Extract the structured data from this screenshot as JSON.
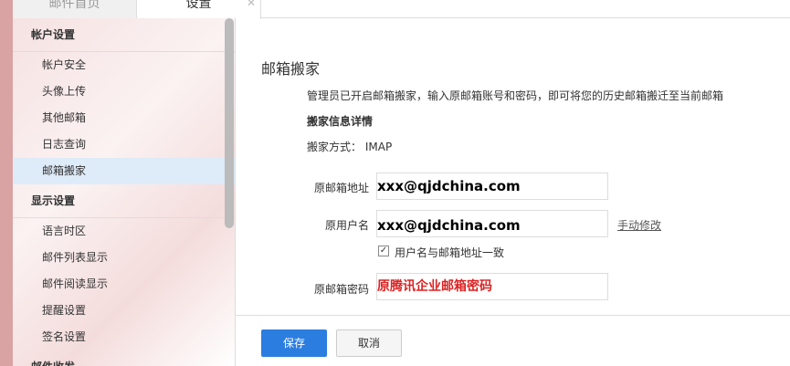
{
  "tabs": [
    {
      "label": "邮件首页"
    },
    {
      "label": "设置"
    }
  ],
  "sidebar": {
    "groups": [
      {
        "title": "帐户设置",
        "items": [
          "帐户安全",
          "头像上传",
          "其他邮箱",
          "日志查询",
          "邮箱搬家"
        ]
      },
      {
        "title": "显示设置",
        "items": [
          "语言时区",
          "邮件列表显示",
          "邮件阅读显示",
          "提醒设置",
          "签名设置"
        ]
      },
      {
        "title": "邮件收发"
      }
    ],
    "active": "邮箱搬家"
  },
  "main": {
    "title": "邮箱搬家",
    "description": "管理员已开启邮箱搬家，输入原邮箱账号和密码，即可将您的历史邮箱搬迁至当前邮箱",
    "details_heading": "搬家信息详情",
    "method_label": "搬家方式：",
    "method_value": "IMAP",
    "fields": {
      "address_label": "原邮箱地址",
      "address_value": "xxx@qjdchina.com",
      "username_label": "原用户名",
      "username_value": "xxx@qjdchina.com",
      "manual_edit": "手动修改",
      "same_checkbox_label": "用户名与邮箱地址一致",
      "same_checked": true,
      "password_label": "原邮箱密码",
      "password_value": "原腾讯企业邮箱密码"
    },
    "save": "保存",
    "cancel": "取消"
  }
}
